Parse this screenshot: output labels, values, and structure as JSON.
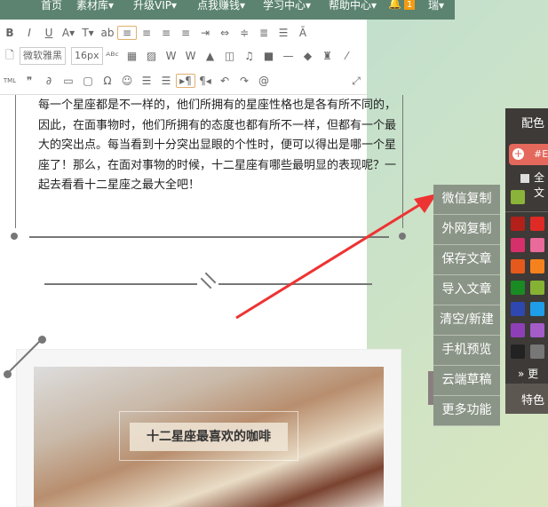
{
  "nav": {
    "items": [
      "首页",
      "素材库▾",
      "升级VIP▾",
      "点我赚钱▾",
      "学习中心▾",
      "帮助中心▾"
    ],
    "badge": "1",
    "user": "瑞▾"
  },
  "toolbar": {
    "font": "微软雅黑",
    "size": "16px"
  },
  "content": {
    "paragraph": "每一个星座都是不一样的，他们所拥有的星座性格也是各有所不同的，因此，在面事物时，他们所拥有的态度也都有所不一样，但都有一个最大的突出点。每当看到十分突出显眼的个性时，便可以得出是哪一个星座了！那么，在面对事物的时候，十二星座有哪些最明显的表现呢？一起去看看十二星座之最大全吧！",
    "image_title": "十二星座最喜欢的咖啡"
  },
  "side_menu": [
    "微信复制",
    "外网复制",
    "保存文章",
    "导入文章",
    "清空/新建",
    "手机预览",
    "云端草稿",
    "更多功能"
  ],
  "panel": {
    "title": "配色",
    "color_input": "#EF",
    "all_label": "全文",
    "more": "更多",
    "special": "特色"
  },
  "swatches": [
    "#8ab339",
    "#b3201a",
    "#e02a25",
    "#d6306a",
    "#ea6a9b",
    "#e55a1c",
    "#f6821e",
    "#1a8a22",
    "#86b233",
    "#2e48b0",
    "#1e9ee8",
    "#8e3fb7",
    "#a45cc9",
    "#222222",
    "#777777"
  ],
  "colors": {
    "nav": "#5b8370",
    "side": "#8b9587",
    "panel": "#3d3a37",
    "arrow": "#ee3333"
  }
}
